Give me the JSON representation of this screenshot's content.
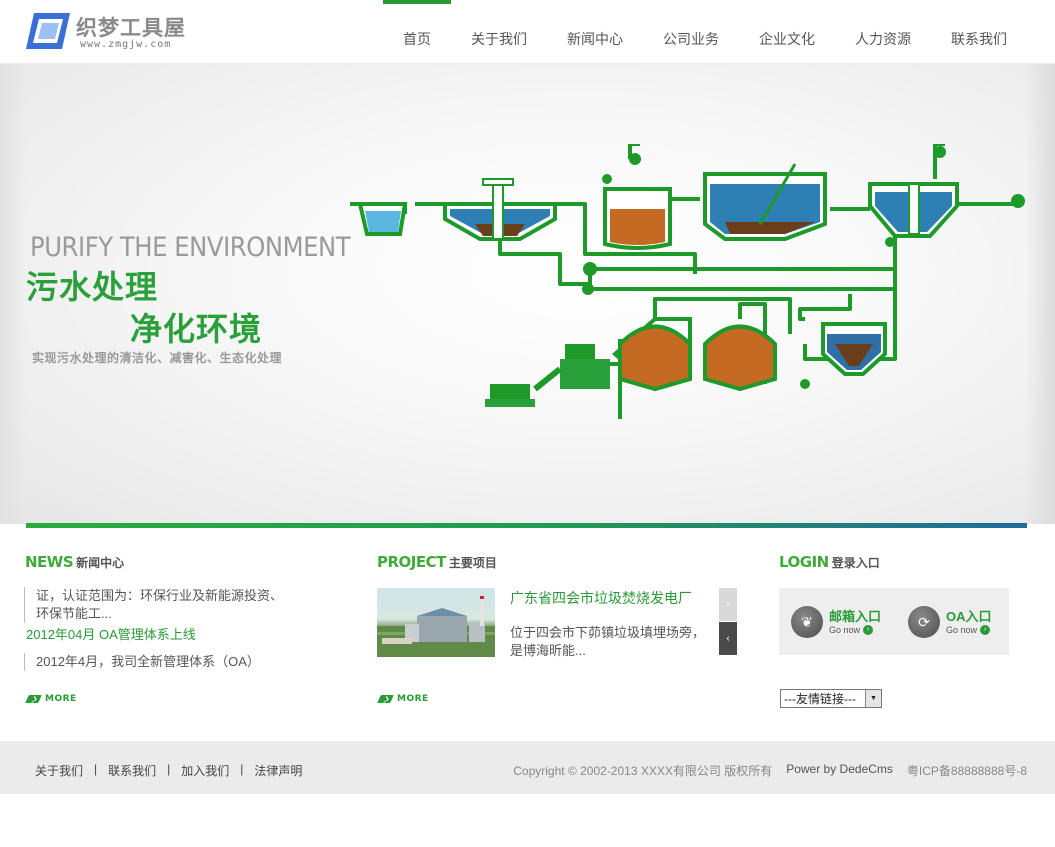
{
  "header": {
    "logo_name": "织梦工具屋",
    "logo_url": "www.zmgjw.com",
    "nav": [
      {
        "label": "首页",
        "active": true
      },
      {
        "label": "关于我们"
      },
      {
        "label": "新闻中心"
      },
      {
        "label": "公司业务"
      },
      {
        "label": "企业文化"
      },
      {
        "label": "人力资源"
      },
      {
        "label": "联系我们"
      }
    ]
  },
  "banner": {
    "kicker": "PURIFY THE ENVIRONMENT",
    "headline_1": "污水处理",
    "headline_2": "净化环境",
    "subline": "实现污水处理的清洁化、减害化、生态化处理",
    "slides": 4,
    "active_slide": 3,
    "accent_color": "#2aa03a"
  },
  "news": {
    "title_en": "NEWS",
    "title_cn": "新闻中心",
    "item1_text": "证，认证范围为：环保行业及新能源投资、环保节能工...",
    "item2_link": "2012年04月 OA管理体系上线",
    "item3_text": "2012年4月，我司全新管理体系（OA）",
    "more": "MORE"
  },
  "project": {
    "title_en": "PROJECT",
    "title_cn": "主要项目",
    "item_title": "广东省四会市垃圾焚烧发电厂",
    "item_desc": "位于四会市下茆镇垃圾填埋场旁，是博海昕能...",
    "next_icon": "chevron-right-icon",
    "prev_icon": "chevron-left-icon",
    "more": "MORE"
  },
  "login": {
    "title_en": "LOGIN",
    "title_cn": "登录入口",
    "mail_label": "邮箱入口",
    "oa_label": "OA入口",
    "go_now": "Go now"
  },
  "links_select": {
    "selected": "---友情链接---"
  },
  "footer": {
    "links": [
      "关于我们",
      "联系我们",
      "加入我们",
      "法律声明"
    ],
    "copyright": "Copyright © 2002-2013 XXXX有限公司 版权所有",
    "powered": "Power by DedeCms",
    "icp": "粤ICP备88888888号-8"
  },
  "colors": {
    "brand_green": "#2a9a37",
    "footer_bg": "#ebebeb",
    "gradient_end": "#1f6b9e"
  }
}
